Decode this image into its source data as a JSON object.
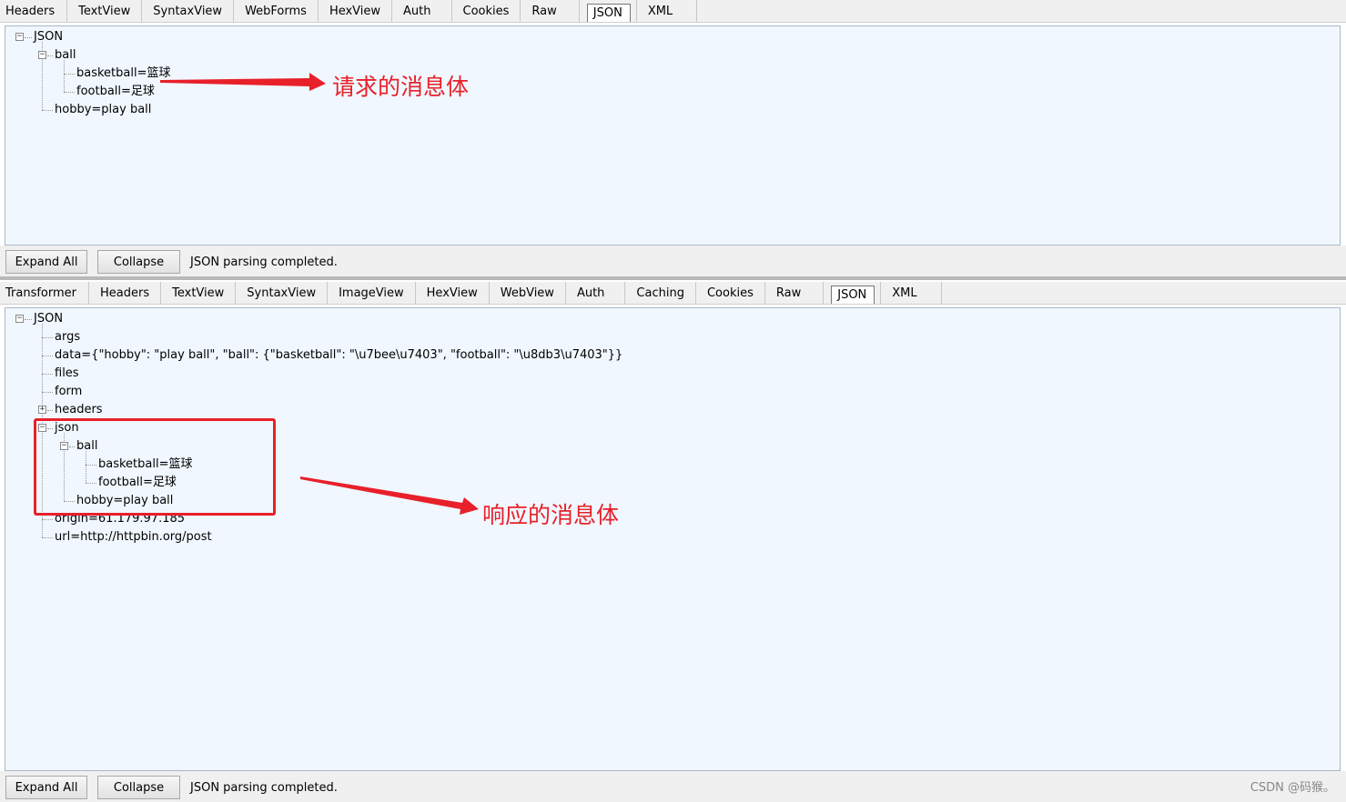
{
  "request": {
    "tabs": [
      "Headers",
      "TextView",
      "SyntaxView",
      "WebForms",
      "HexView",
      "Auth",
      "Cookies",
      "Raw",
      "JSON",
      "XML"
    ],
    "active_tab": "JSON",
    "tree": {
      "root": "JSON",
      "ball": "ball",
      "basketball": "basketball=篮球",
      "football": "football=足球",
      "hobby": "hobby=play ball"
    },
    "expand_all": "Expand All",
    "collapse": "Collapse",
    "status": "JSON parsing completed.",
    "annotation": "请求的消息体"
  },
  "response": {
    "tabs": [
      "Transformer",
      "Headers",
      "TextView",
      "SyntaxView",
      "ImageView",
      "HexView",
      "WebView",
      "Auth",
      "Caching",
      "Cookies",
      "Raw",
      "JSON",
      "XML"
    ],
    "active_tab": "JSON",
    "tree": {
      "root": "JSON",
      "args": "args",
      "data": "data={\"hobby\": \"play ball\", \"ball\": {\"basketball\": \"\\u7bee\\u7403\", \"football\": \"\\u8db3\\u7403\"}}",
      "files": "files",
      "form": "form",
      "headers": "headers",
      "json": "json",
      "ball": "ball",
      "basketball": "basketball=篮球",
      "football": "football=足球",
      "hobby": "hobby=play ball",
      "origin": "origin=61.179.97.185",
      "url": "url=http://httpbin.org/post"
    },
    "expand_all": "Expand All",
    "collapse": "Collapse",
    "status": "JSON parsing completed.",
    "annotation": "响应的消息体"
  },
  "watermark": "CSDN @码猴。",
  "colors": {
    "annotation": "#e8202a",
    "panel_bg": "#f0f7ff"
  }
}
